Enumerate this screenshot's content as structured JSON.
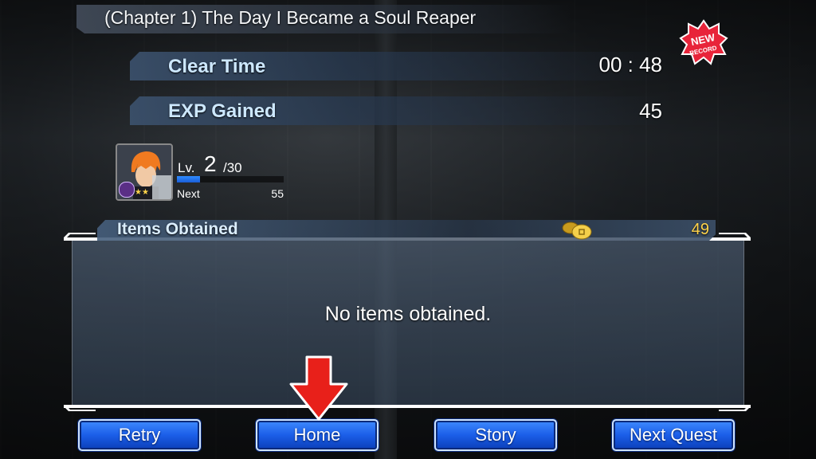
{
  "title": "(Chapter 1) The Day I Became a Soul Reaper",
  "stats": {
    "clear_time_label": "Clear Time",
    "clear_time_value": "00 : 48",
    "exp_label": "EXP Gained",
    "exp_value": "45",
    "new_record_text": "NEW RECORD"
  },
  "character": {
    "lv_label": "Lv.",
    "level": "2",
    "max_level": "/30",
    "next_label": "Next",
    "next_value": "55",
    "exp_progress": 0.22,
    "stars": "★★"
  },
  "items": {
    "label": "Items Obtained",
    "coins": "49",
    "empty_message": "No items obtained."
  },
  "buttons": {
    "retry": "Retry",
    "home": "Home",
    "story": "Story",
    "next_quest": "Next Quest"
  },
  "colors": {
    "accent_blue": "#1b5ee8",
    "coin_gold": "#ffd34a",
    "arrow_red": "#e8201a",
    "badge_red": "#e8243a"
  }
}
